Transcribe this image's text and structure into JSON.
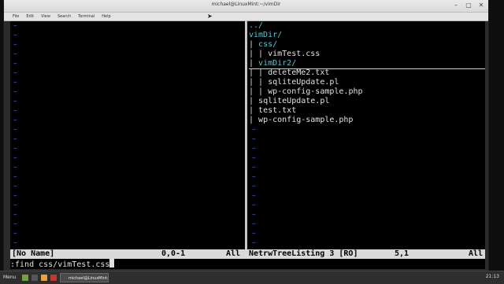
{
  "window": {
    "title": "michael@LinuxMint:~/vimDir",
    "buttons": [
      "–",
      "▢",
      "✕"
    ],
    "menu": [
      "File",
      "Edit",
      "View",
      "Search",
      "Terminal",
      "Help"
    ]
  },
  "left_pane": {
    "tilde": "~"
  },
  "right_pane": {
    "tree": [
      {
        "text": "../",
        "type": "dir",
        "indent": "",
        "cursor": false
      },
      {
        "text": "vimDir/",
        "type": "dir",
        "indent": "",
        "cursor": false
      },
      {
        "text": "css/",
        "type": "dir",
        "indent": "| ",
        "cursor": false
      },
      {
        "text": "vimTest.css",
        "type": "file",
        "indent": "| | ",
        "cursor": false
      },
      {
        "text": "vimDir2/",
        "type": "dir",
        "indent": "| ",
        "cursor": true
      },
      {
        "text": "deleteMe2.txt",
        "type": "file",
        "indent": "| | ",
        "cursor": false
      },
      {
        "text": "sqliteUpdate.pl",
        "type": "file",
        "indent": "| | ",
        "cursor": false
      },
      {
        "text": "wp-config-sample.php",
        "type": "file",
        "indent": "| | ",
        "cursor": false
      },
      {
        "text": "sqliteUpdate.pl",
        "type": "file",
        "indent": "| ",
        "cursor": false
      },
      {
        "text": "test.txt",
        "type": "file",
        "indent": "| ",
        "cursor": false
      },
      {
        "text": "wp-config-sample.php",
        "type": "file",
        "indent": "| ",
        "cursor": false
      }
    ],
    "tilde": "~"
  },
  "statusline": {
    "left_name": "[No Name]",
    "left_pos": "0,0-1",
    "left_all": "All",
    "right_name": "NetrwTreeListing 3 [RO]",
    "right_pos": "5,1",
    "right_all": "All"
  },
  "cmdline": {
    "text": ":find css/vimTest.css"
  },
  "taskbar": {
    "menu_label": "Menu",
    "task_label": "michael@LinuxMint:~/vimDir",
    "clock": "21:13",
    "icon_colors": [
      "#6fa33c",
      "#555555",
      "#e8a33d",
      "#c0392b"
    ]
  }
}
